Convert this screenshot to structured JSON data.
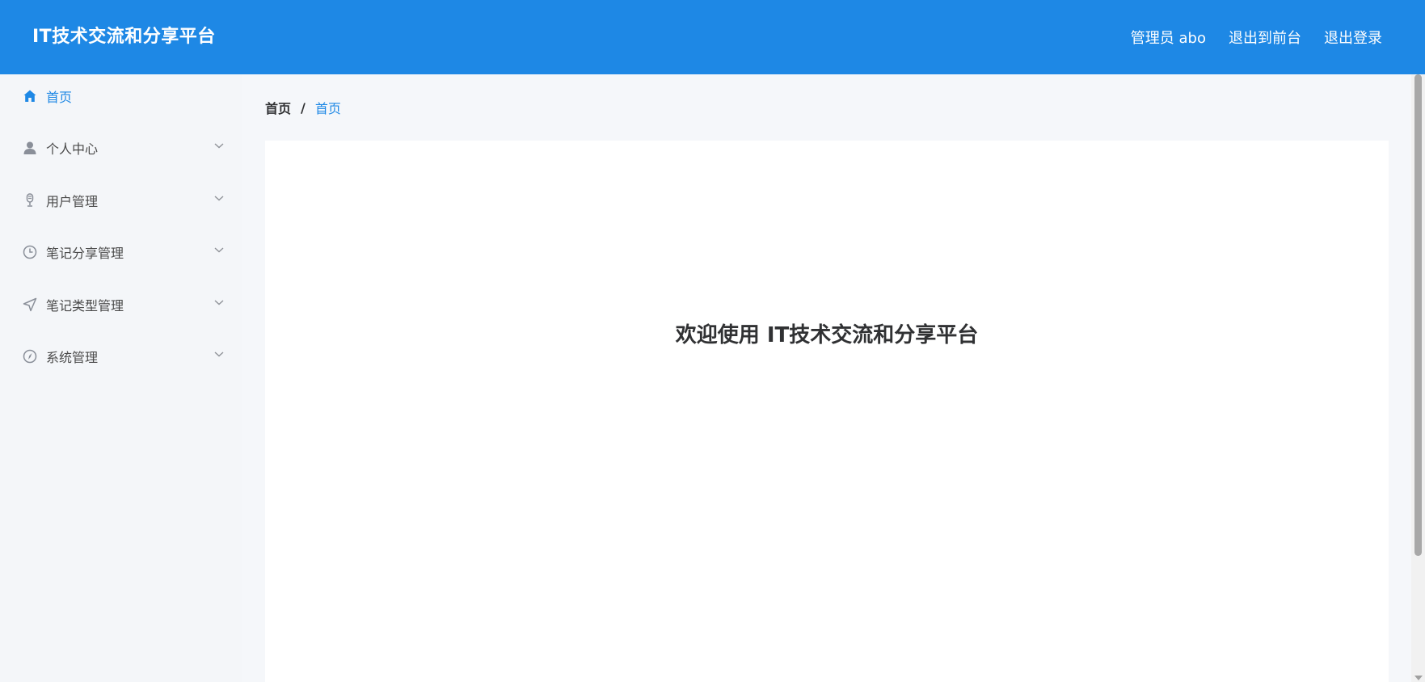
{
  "header": {
    "title": "IT技术交流和分享平台",
    "user_label": "管理员 abo",
    "back_to_front_label": "退出到前台",
    "logout_label": "退出登录"
  },
  "sidebar": {
    "items": [
      {
        "label": "首页",
        "icon": "home-icon",
        "active": true
      },
      {
        "label": "个人中心",
        "icon": "user-icon"
      },
      {
        "label": "用户管理",
        "icon": "microphone-icon"
      },
      {
        "label": "笔记分享管理",
        "icon": "clock-icon"
      },
      {
        "label": "笔记类型管理",
        "icon": "send-icon"
      },
      {
        "label": "系统管理",
        "icon": "compass-icon"
      }
    ]
  },
  "breadcrumb": {
    "home": "首页",
    "separator": "/",
    "current": "首页"
  },
  "main": {
    "welcome": "欢迎使用 IT技术交流和分享平台"
  },
  "colors": {
    "primary": "#1e88e5",
    "sidebar_bg": "#f4f6f9",
    "page_bg": "#f5f7fa",
    "text": "#303133"
  }
}
